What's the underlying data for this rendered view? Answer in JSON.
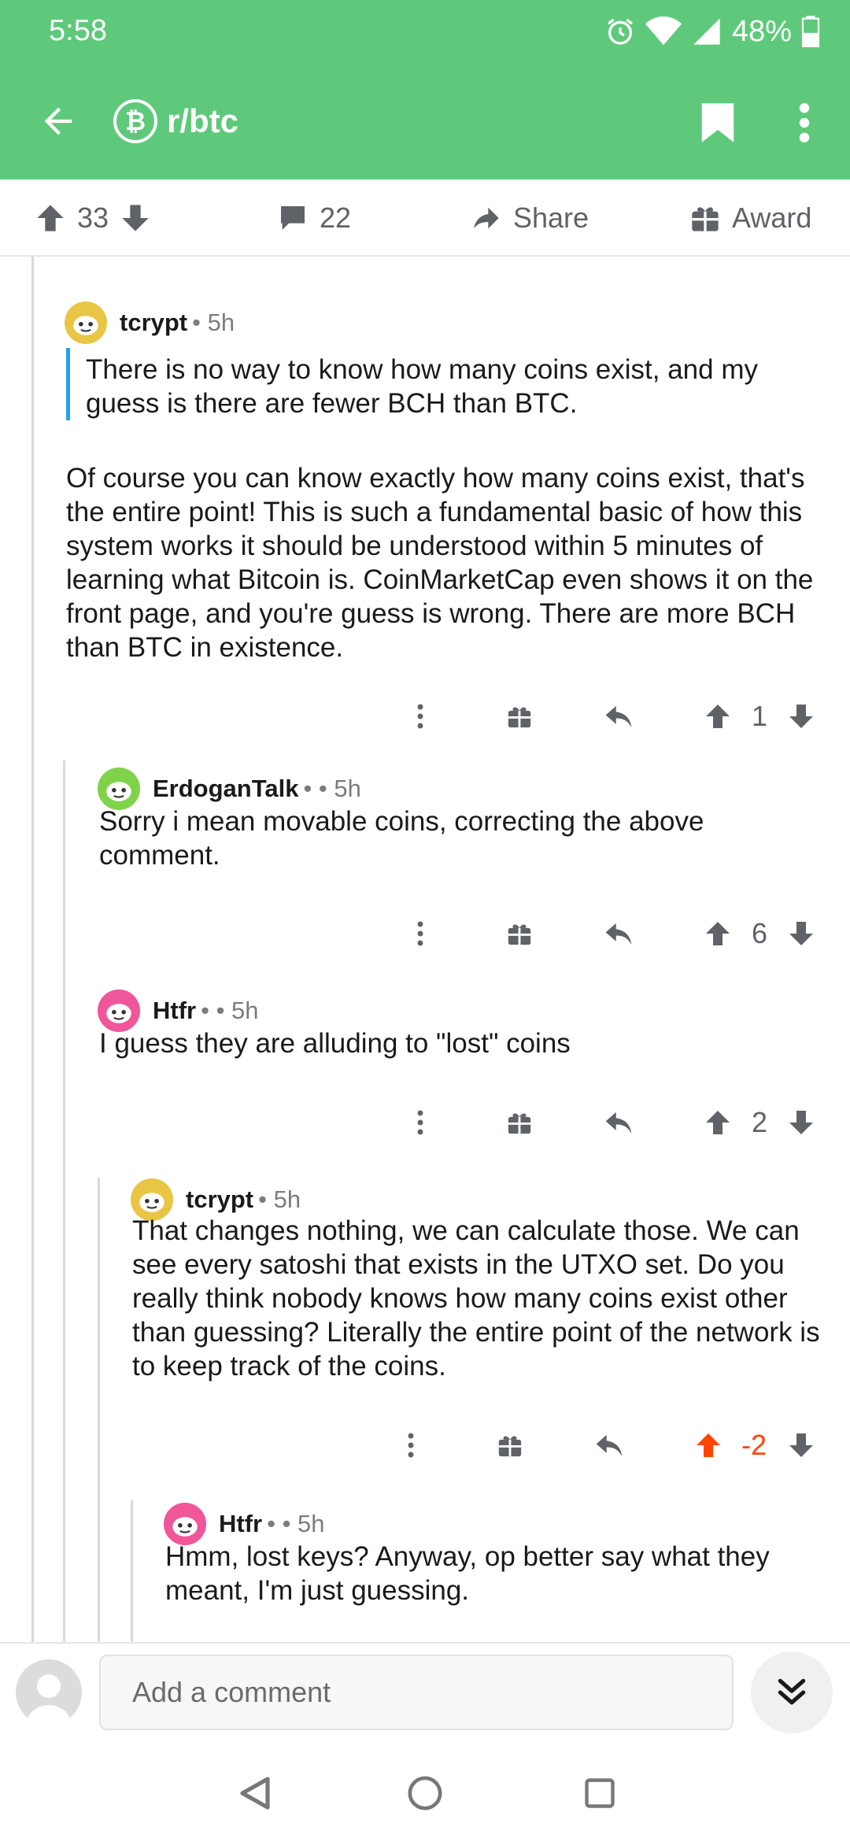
{
  "status_bar": {
    "time": "5:58",
    "battery": "48%"
  },
  "colors": {
    "header": "#5ec97a",
    "accent_link": "#24a0ed",
    "downvote_orange": "#ff4500",
    "icon_gray": "#5f6368"
  },
  "app_bar": {
    "subreddit": "r/btc",
    "subreddit_icon_glyph": "₿"
  },
  "post_actions": {
    "score": "33",
    "comments": "22",
    "share_label": "Share",
    "award_label": "Award"
  },
  "comments": [
    {
      "author": "tcrypt",
      "meta": "• 5h",
      "avatar_color": "#e9c545",
      "quote": "There is no way to know how many coins exist, and my guess is there are fewer BCH than BTC.",
      "body": "Of course you can know exactly how many coins exist, that's the entire point! This is such a fundamental basic of how this system works it should be understood within 5 minutes of learning what Bitcoin is. CoinMarketCap even shows it on the front page, and you're guess is wrong. There are more BCH than BTC in existence.",
      "score": "1",
      "vote_state": "none"
    },
    {
      "author": "ErdoganTalk",
      "meta": "• • 5h",
      "avatar_color": "#7fd34a",
      "body": "Sorry i mean movable coins, correcting the above comment.",
      "score": "6",
      "vote_state": "none"
    },
    {
      "author": "Htfr",
      "meta": "• • 5h",
      "avatar_color": "#f0569a",
      "body": "I guess they are alluding to \"lost\" coins",
      "score": "2",
      "vote_state": "none"
    },
    {
      "author": "tcrypt",
      "meta": "• 5h",
      "avatar_color": "#e9c545",
      "body": "That changes nothing, we can calculate those. We can see every satoshi that exists in the UTXO set. Do you really think nobody knows how many coins exist other than guessing? Literally the entire point of the network is to keep track of the coins.",
      "score": "-2",
      "vote_state": "upvoted"
    },
    {
      "author": "Htfr",
      "meta": "• • 5h",
      "avatar_color": "#f0569a",
      "body": "Hmm, lost keys? Anyway, op better say what they meant, I'm just guessing."
    }
  ],
  "composer": {
    "placeholder": "Add a comment"
  },
  "icons": {
    "back": "arrow-left-icon",
    "bookmark": "bookmark-icon",
    "overflow": "more-vertical-icon",
    "upvote": "arrow-up-icon",
    "downvote": "arrow-down-icon",
    "comment": "comment-bubble-icon",
    "share": "share-arrow-icon",
    "award": "gift-icon",
    "reply": "reply-arrow-icon",
    "scroll": "double-chevron-down-icon"
  }
}
